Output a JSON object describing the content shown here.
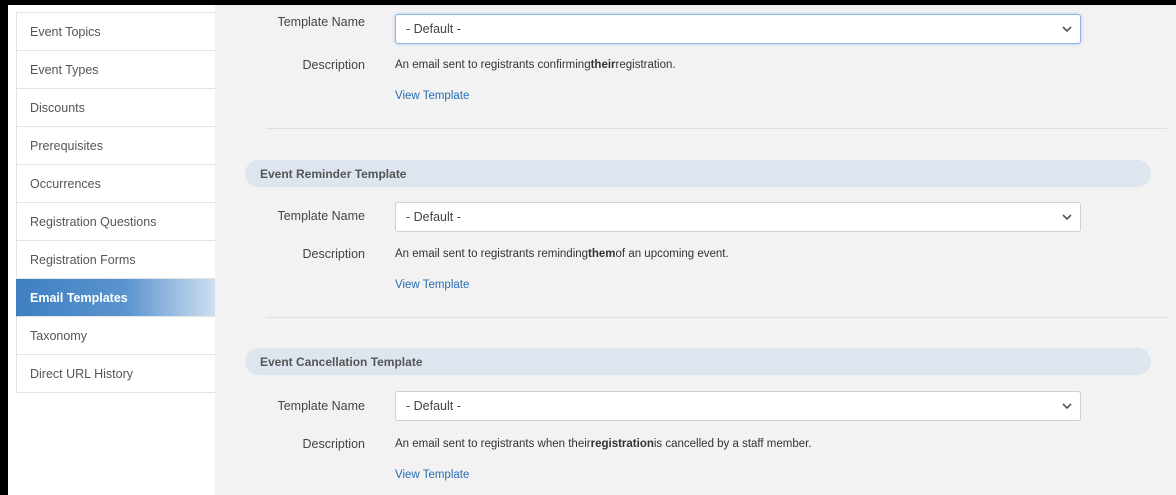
{
  "sidebar": {
    "items": [
      {
        "label": "Event Topics",
        "active": false
      },
      {
        "label": "Event Types",
        "active": false
      },
      {
        "label": "Discounts",
        "active": false
      },
      {
        "label": "Prerequisites",
        "active": false
      },
      {
        "label": "Occurrences",
        "active": false
      },
      {
        "label": "Registration Questions",
        "active": false
      },
      {
        "label": "Registration Forms",
        "active": false
      },
      {
        "label": "Email Templates",
        "active": true
      },
      {
        "label": "Taxonomy",
        "active": false
      },
      {
        "label": "Direct URL History",
        "active": false
      }
    ]
  },
  "sections": {
    "confirmation": {
      "template_label": "Template Name",
      "template_value": "- Default -",
      "description_label": "Description",
      "description_parts": [
        "An email sent to registrants confirming ",
        "their",
        " registration."
      ],
      "view_link": "View Template"
    },
    "reminder": {
      "title": "Event Reminder Template",
      "template_label": "Template Name",
      "template_value": "- Default -",
      "description_label": "Description",
      "description_parts": [
        "An email sent to registrants reminding ",
        "them",
        " of an upcoming event."
      ],
      "view_link": "View Template"
    },
    "cancellation": {
      "title": "Event Cancellation Template",
      "template_label": "Template Name",
      "template_value": "- Default -",
      "description_label": "Description",
      "description_parts": [
        "An email sent to registrants when their ",
        "registration",
        " is cancelled by a staff member."
      ],
      "view_link": "View Template"
    }
  },
  "colors": {
    "active_item": "#3f7fc1",
    "panel_header": "#dde6ef",
    "link": "#2a6db5"
  },
  "icons": {
    "select_arrow": "chevron-down-icon"
  }
}
